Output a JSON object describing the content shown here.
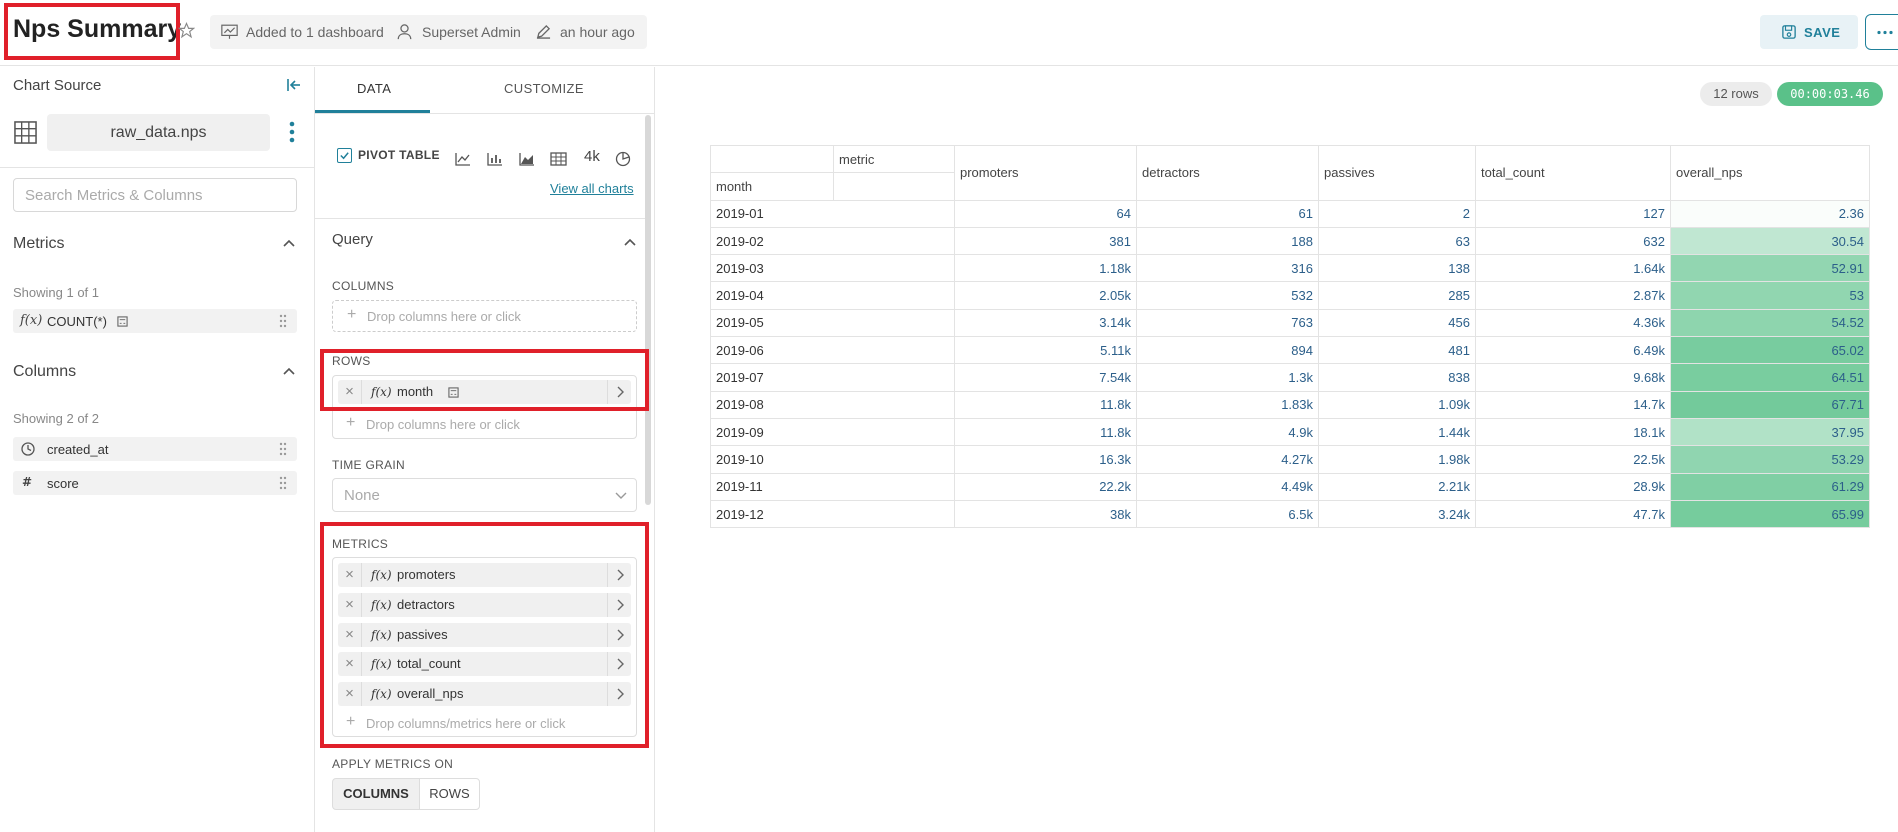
{
  "header": {
    "title": "Nps Summary",
    "dashboard_text": "Added to 1 dashboard",
    "owner": "Superset Admin",
    "modified": "an hour ago",
    "save_label": "SAVE"
  },
  "left_panel": {
    "chart_source_label": "Chart Source",
    "dataset_name": "raw_data.nps",
    "search_placeholder": "Search Metrics & Columns",
    "metrics_title": "Metrics",
    "metrics_showing": "Showing 1 of 1",
    "metrics": [
      {
        "name": "COUNT(*)"
      }
    ],
    "columns_title": "Columns",
    "columns_showing": "Showing 2 of 2",
    "columns": [
      {
        "name": "created_at",
        "icon": "clock-icon"
      },
      {
        "name": "score",
        "icon": "hash-icon"
      }
    ]
  },
  "control_panel": {
    "tabs": [
      "DATA",
      "CUSTOMIZE"
    ],
    "active_tab": "DATA",
    "viz_type": "PIVOT TABLE",
    "viz_extra": "4k",
    "view_all_charts": "View all charts",
    "query_title": "Query",
    "columns_label": "COLUMNS",
    "drop_columns": "Drop columns here or click",
    "rows_label": "ROWS",
    "rows": [
      "month"
    ],
    "time_grain_label": "TIME GRAIN",
    "time_grain_value": "None",
    "metrics_label": "METRICS",
    "metrics": [
      "promoters",
      "detractors",
      "passives",
      "total_count",
      "overall_nps"
    ],
    "drop_metrics": "Drop columns/metrics here or click",
    "apply_metrics_label": "APPLY METRICS ON",
    "apply_options": [
      "COLUMNS",
      "ROWS"
    ],
    "apply_selected": "COLUMNS"
  },
  "results": {
    "row_count": "12 rows",
    "timer": "00:00:03.46",
    "metric_header": "metric",
    "row_header": "month",
    "columns": [
      "promoters",
      "detractors",
      "passives",
      "total_count",
      "overall_nps"
    ],
    "rows": [
      {
        "month": "2019-01",
        "values": [
          "64",
          "61",
          "2",
          "127",
          "2.36"
        ],
        "nps": 2.36
      },
      {
        "month": "2019-02",
        "values": [
          "381",
          "188",
          "63",
          "632",
          "30.54"
        ],
        "nps": 30.54
      },
      {
        "month": "2019-03",
        "values": [
          "1.18k",
          "316",
          "138",
          "1.64k",
          "52.91"
        ],
        "nps": 52.91
      },
      {
        "month": "2019-04",
        "values": [
          "2.05k",
          "532",
          "285",
          "2.87k",
          "53"
        ],
        "nps": 53
      },
      {
        "month": "2019-05",
        "values": [
          "3.14k",
          "763",
          "456",
          "4.36k",
          "54.52"
        ],
        "nps": 54.52
      },
      {
        "month": "2019-06",
        "values": [
          "5.11k",
          "894",
          "481",
          "6.49k",
          "65.02"
        ],
        "nps": 65.02
      },
      {
        "month": "2019-07",
        "values": [
          "7.54k",
          "1.3k",
          "838",
          "9.68k",
          "64.51"
        ],
        "nps": 64.51
      },
      {
        "month": "2019-08",
        "values": [
          "11.8k",
          "1.83k",
          "1.09k",
          "14.7k",
          "67.71"
        ],
        "nps": 67.71
      },
      {
        "month": "2019-09",
        "values": [
          "11.8k",
          "4.9k",
          "1.44k",
          "18.1k",
          "37.95"
        ],
        "nps": 37.95
      },
      {
        "month": "2019-10",
        "values": [
          "16.3k",
          "4.27k",
          "1.98k",
          "22.5k",
          "53.29"
        ],
        "nps": 53.29
      },
      {
        "month": "2019-11",
        "values": [
          "22.2k",
          "4.49k",
          "2.21k",
          "28.9k",
          "61.29"
        ],
        "nps": 61.29
      },
      {
        "month": "2019-12",
        "values": [
          "38k",
          "6.5k",
          "3.24k",
          "47.7k",
          "65.99"
        ],
        "nps": 65.99
      }
    ]
  },
  "colors": {
    "accent": "#20809a",
    "highlight": "#e0202a",
    "timer_bg": "#5ac189",
    "heat": "#b4e4c8"
  }
}
